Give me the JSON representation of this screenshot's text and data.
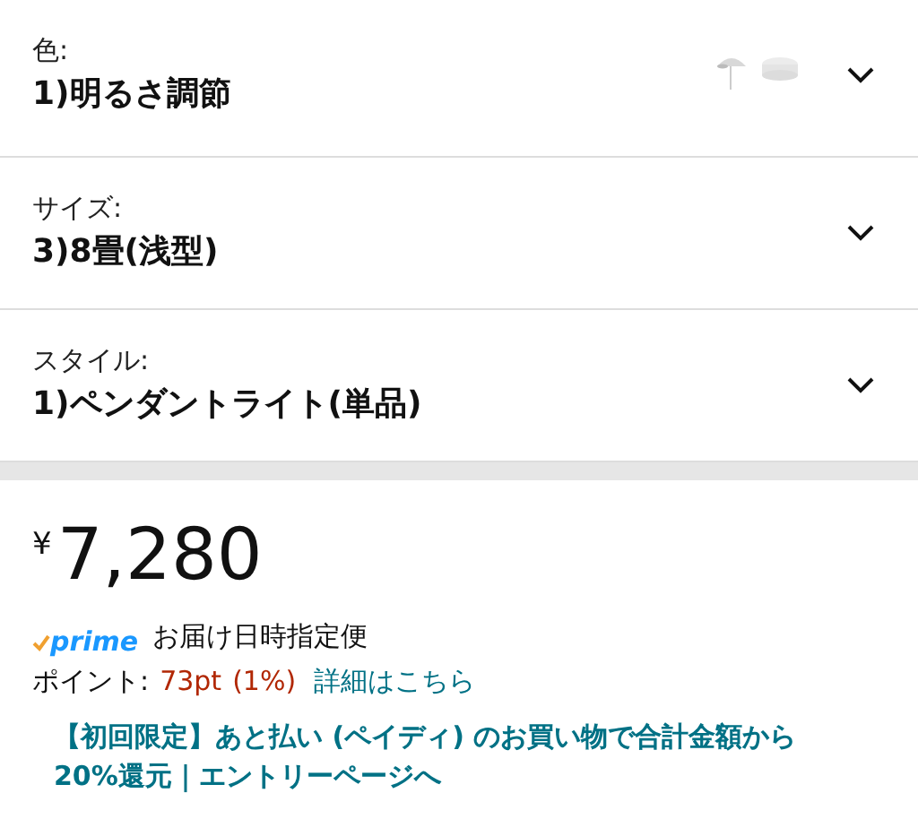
{
  "variations": [
    {
      "label": "色:",
      "value": "1)明るさ調節",
      "has_picture": true
    },
    {
      "label": "サイズ:",
      "value": "3)8畳(浅型)",
      "has_picture": false
    },
    {
      "label": "スタイル:",
      "value": "1)ペンダントライト(単品)",
      "has_picture": false
    }
  ],
  "price": {
    "currency": "¥",
    "amount": "7,280"
  },
  "prime": {
    "logo": "prime",
    "delivery": "お届け日時指定便"
  },
  "points": {
    "label": "ポイント:",
    "value": "73pt",
    "percent": "(1%)",
    "link": "詳細はこちら"
  },
  "promo": {
    "text": "【初回限定】あと払い (ペイディ) のお買い物で合計金額から20%還元｜エントリーページへ"
  }
}
